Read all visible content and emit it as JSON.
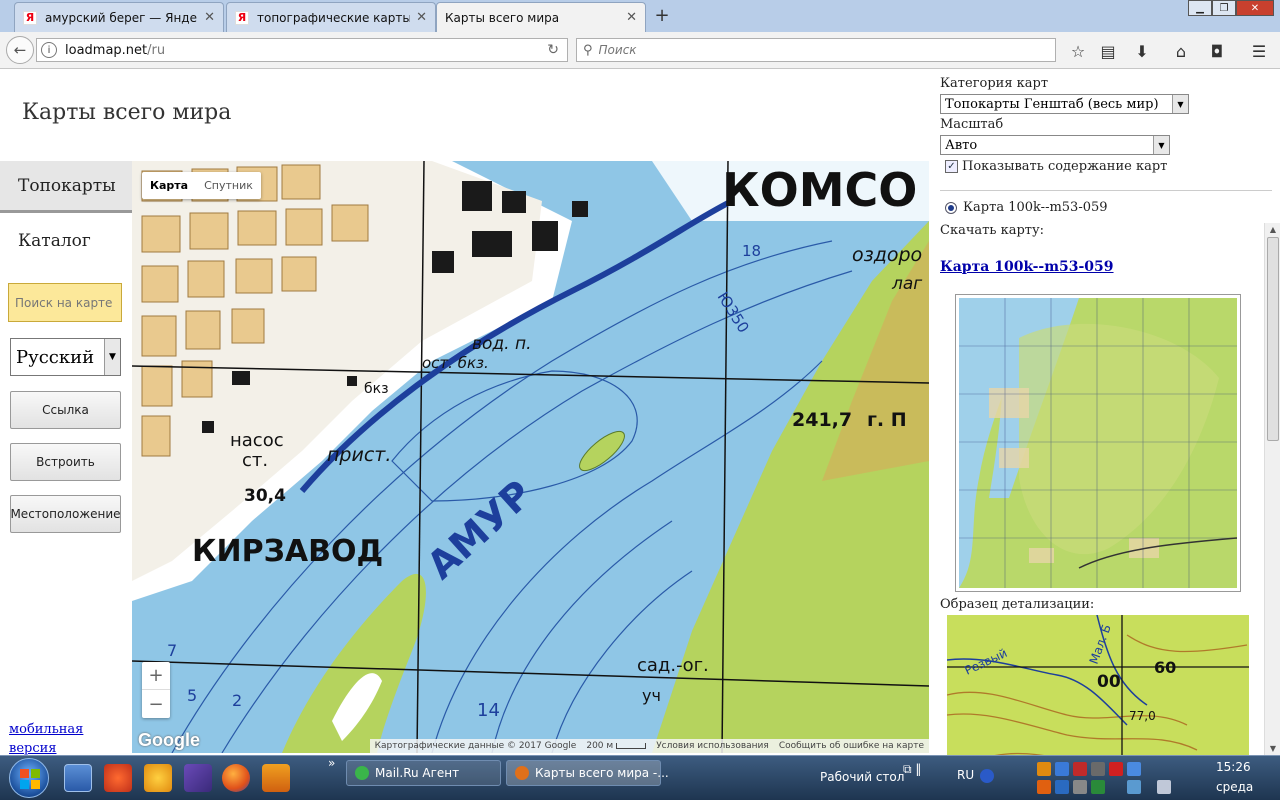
{
  "browser": {
    "tabs": [
      {
        "label": "амурский берег — Яндек...",
        "favicon": "Я"
      },
      {
        "label": "топографические карты ...",
        "favicon": "Я"
      },
      {
        "label": "Карты всего мира",
        "favicon": ""
      }
    ],
    "new_tab": "+",
    "url_host": "loadmap.net",
    "url_path": "/ru",
    "search_placeholder": "Поиск"
  },
  "page": {
    "title": "Карты всего мира",
    "nav": {
      "topo": "Топокарты",
      "catalog": "Каталог"
    },
    "map_search_placeholder": "Поиск на карте",
    "language": "Русский",
    "buttons": {
      "link": "Ссылка",
      "embed": "Встроить",
      "location": "Местоположение"
    },
    "mobile_link": "мобильная версия"
  },
  "map": {
    "type_map": "Карта",
    "type_satellite": "Спутник",
    "zoom_in": "+",
    "zoom_out": "−",
    "google_logo": "Google",
    "attribution": "Картографические данные © 2017 Google",
    "scale": "200 м",
    "terms": "Условия использования",
    "report": "Сообщить об ошибке на карте",
    "labels": {
      "city": "КОМСО",
      "river": "АМУР",
      "district": "КИРЗАВОД",
      "pump": "насос",
      "pump2": "ст.",
      "pier": "прист.",
      "water": "вод. п.",
      "water2": "ост. бкз.",
      "bkz": "бкз",
      "height1": "30,4",
      "height2": "241,7",
      "height2_suffix": "г. П",
      "spot18": "18",
      "spot14": "14",
      "spot7": "7",
      "spot5": "5",
      "spot2": "2",
      "c350": "Ю350",
      "lagoon": "оздоро",
      "lagoon2": "лаг",
      "sadog": "сад.-ог.",
      "uch": "уч"
    }
  },
  "panel": {
    "category_label": "Категория карт",
    "category_value": "Топокарты Генштаб (весь мир)",
    "scale_label": "Масштаб",
    "scale_value": "Авто",
    "show_content": "Показывать содержание карт",
    "radio_map": "Карта 100k--m53-059",
    "download_label": "Скачать карту:",
    "map_link": "Карта 100k--m53-059",
    "sample_label": "Образец детализации:",
    "sample_labels": {
      "rezvy": "Резвый",
      "mal": "Мал. Б",
      "n60": "60",
      "n00": "00",
      "n77": "77,0"
    }
  },
  "taskbar": {
    "items": [
      {
        "label": "Mail.Ru Агент"
      },
      {
        "label": "Карты всего мира -..."
      }
    ],
    "overflow": "»",
    "desktop": "Рабочий стол",
    "lang": "RU",
    "time": "15:26",
    "day": "среда"
  },
  "colors": {
    "water": "#8fc6e6",
    "land_green": "#b5d35e",
    "urban": "#e9c98e",
    "search_bg": "#fce89a",
    "link": "#0000aa"
  }
}
